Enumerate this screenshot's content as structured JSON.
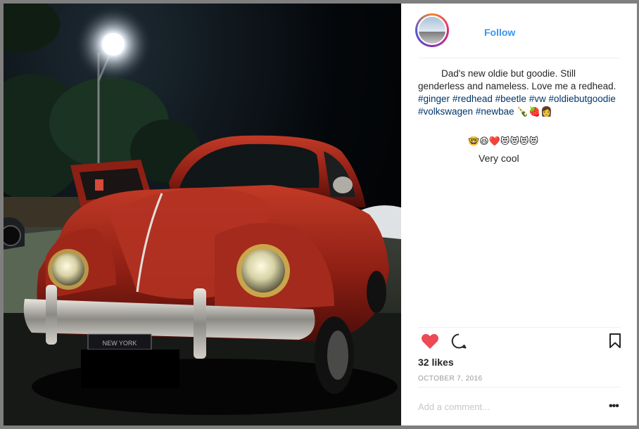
{
  "post": {
    "follow_label": "Follow",
    "caption": {
      "text": "Dad's new oldie but goodie. Still genderless and nameless. Love me a redhead.",
      "hashtags": [
        "#ginger",
        "#redhead",
        "#beetle",
        "#vw",
        "#oldiebutgoodie",
        "#volkswagen",
        "#newbae"
      ],
      "trailing_emoji": "🍾🍓👩"
    },
    "comments": [
      {
        "text": "🤓😆❤️😻😻😻😻"
      },
      {
        "text": "Very cool"
      }
    ],
    "likes": "32 likes",
    "date": "OCTOBER 7, 2016",
    "comment_placeholder": "Add a comment...",
    "more_label": "•••"
  },
  "photo": {
    "license_plate": "NEW YORK"
  },
  "colors": {
    "like_heart": "#ed4956",
    "link": "#003569",
    "follow": "#3897f0"
  }
}
